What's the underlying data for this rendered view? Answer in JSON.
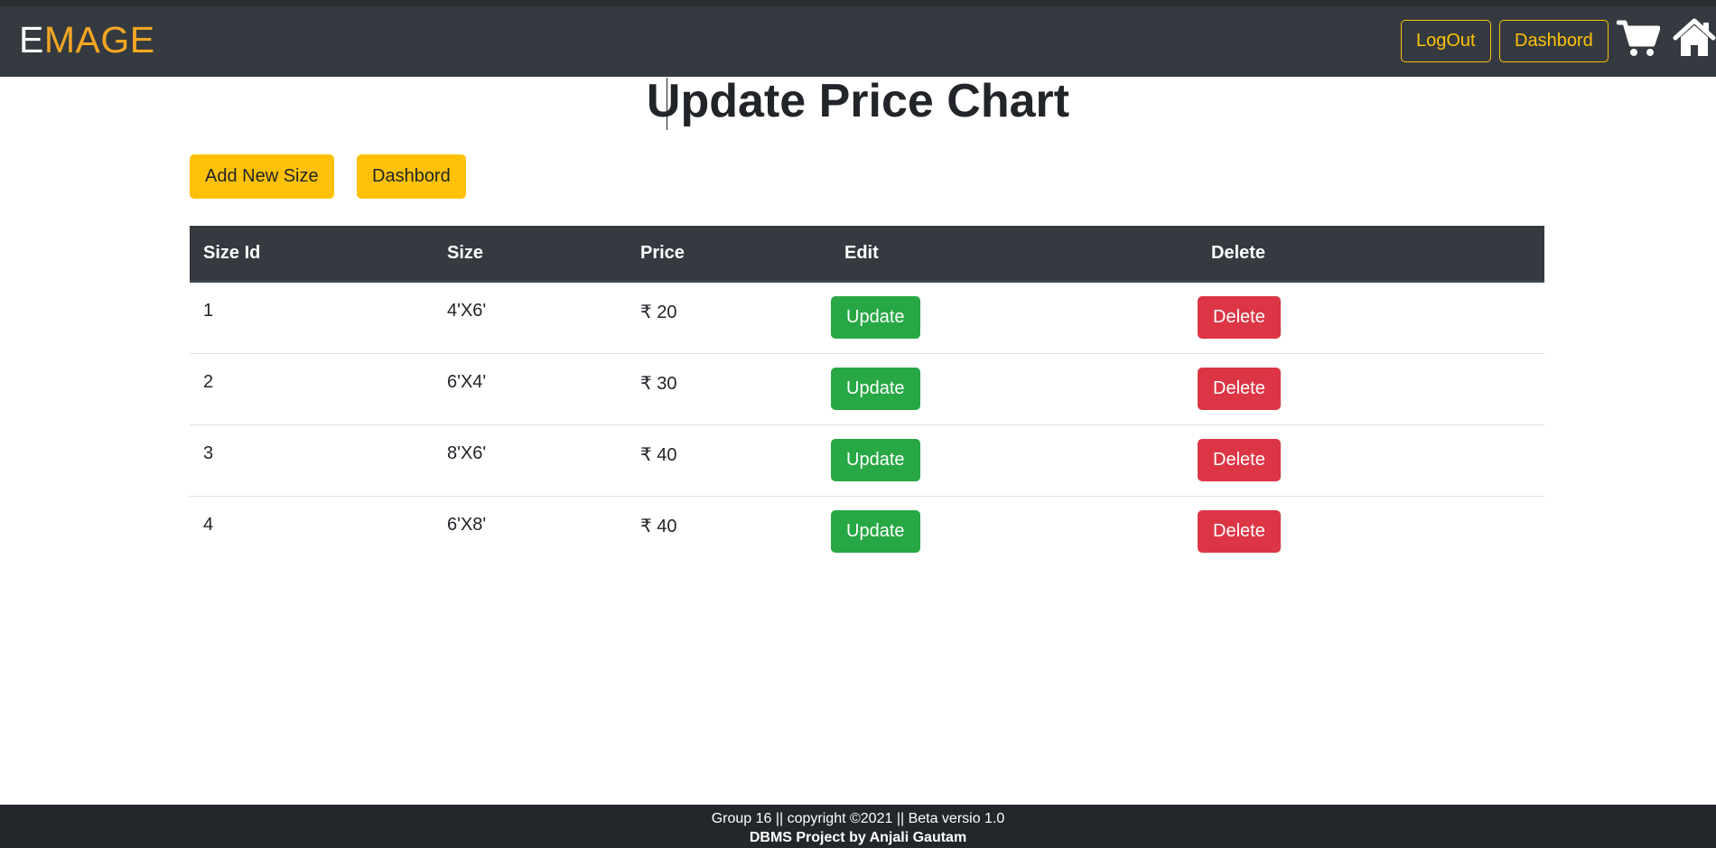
{
  "brand": {
    "first_letter": "E",
    "rest": "MAGE"
  },
  "nav": {
    "logout_label": "LogOut",
    "dashboard_label": "Dashbord",
    "cart_icon": "cart-icon",
    "home_icon": "home-icon"
  },
  "page": {
    "title": "Update Price Chart",
    "add_new_size_label": "Add New Size",
    "dashboard_label": "Dashbord"
  },
  "table": {
    "headers": [
      "Size Id",
      "Size",
      "Price",
      "Edit",
      "Delete"
    ],
    "rows": [
      {
        "size_id": "1",
        "size": "4'X6'",
        "price": "₹ 20",
        "edit": "Update",
        "delete": "Delete"
      },
      {
        "size_id": "2",
        "size": "6'X4'",
        "price": "₹ 30",
        "edit": "Update",
        "delete": "Delete"
      },
      {
        "size_id": "3",
        "size": "8'X6'",
        "price": "₹ 40",
        "edit": "Update",
        "delete": "Delete"
      },
      {
        "size_id": "4",
        "size": "6'X8'",
        "price": "₹ 40",
        "edit": "Update",
        "delete": "Delete"
      }
    ]
  },
  "footer": {
    "line1": "Group 16 || copyright ©2021 || Beta versio 1.0",
    "line2": "DBMS Project by Anjali Gautam"
  },
  "colors": {
    "navbar": "#343a40",
    "brand_accent": "#f5a623",
    "warning": "#ffc107",
    "success": "#28a745",
    "danger": "#dc3545",
    "footer": "#23272b"
  }
}
